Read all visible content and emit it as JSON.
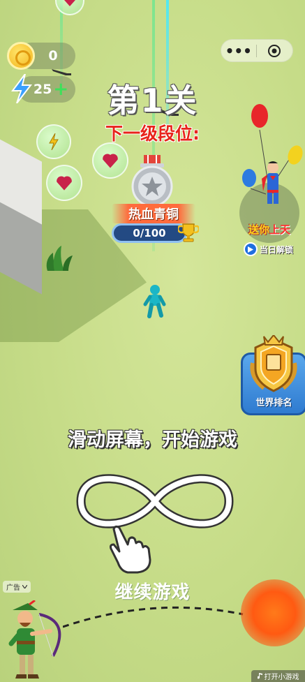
{
  "hud": {
    "coins": "0",
    "energy": "25",
    "energy_plus": "+"
  },
  "level": {
    "title": "第1关",
    "next_rank_label": "下一级段位:",
    "rank_name": "热血青铜",
    "progress_text": "0/100",
    "progress_fraction": 0.0
  },
  "gift": {
    "label_a": "送你",
    "label_b": "上天",
    "unlock_label": "当日解锁"
  },
  "world_rank": {
    "label": "世界排名"
  },
  "instructions": {
    "swipe": "滑动屏幕，开始游戏",
    "continue": "继续游戏"
  },
  "ad": {
    "tag": "广告",
    "open_label": "打开小游戏"
  },
  "colors": {
    "ground": "#c6dc88",
    "title_red": "#e8241b",
    "progress_bg": "#234a83",
    "world_button": "#3d8ddd",
    "fireball": "#ff5a12"
  },
  "icons": {
    "coin": "coin-icon",
    "energy": "lightning-icon",
    "medal": "silver-star-medal-icon",
    "trophy": "trophy-icon",
    "world": "laurel-emblem-icon",
    "hand": "pointing-hand-icon",
    "heart": "heart-icon"
  }
}
